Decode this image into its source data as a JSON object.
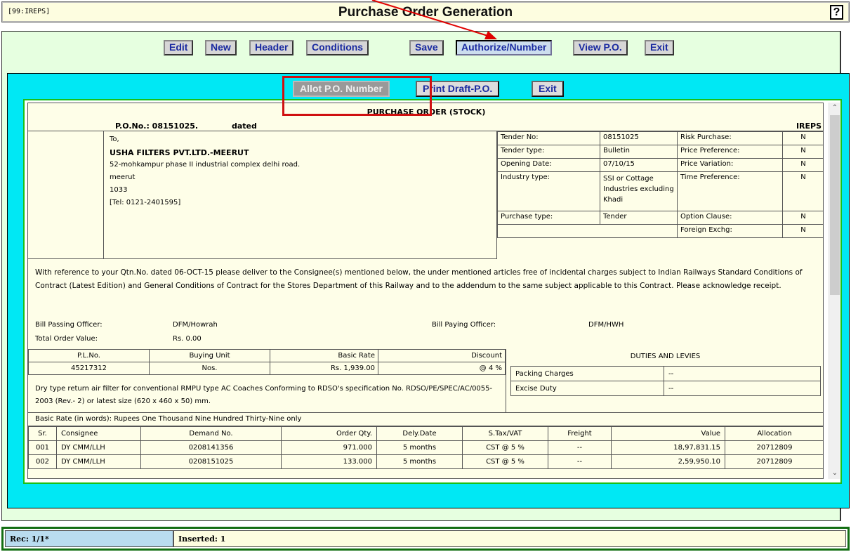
{
  "window": {
    "code": "[99:IREPS]",
    "title": "Purchase Order Generation",
    "help": "?"
  },
  "toolbar": [
    "Edit",
    "New",
    "Header",
    "Conditions",
    "Save",
    "Authorize/Number",
    "View P.O.",
    "Exit"
  ],
  "subtoolbar": {
    "allot": "Allot P.O. Number",
    "print": "Print Draft-P.O.",
    "exit": "Exit"
  },
  "doc": {
    "title": "PURCHASE ORDER (STOCK)",
    "po_no": "P.O.No.: 08151025.",
    "dated": "dated",
    "org": "IREPS",
    "to": "To,",
    "vendor": "USHA FILTERS PVT.LTD.-MEERUT",
    "addr1": "52-mohkampur phase II industrial complex delhi road.",
    "addr2": "meerut",
    "addr3": "1033",
    "tel": "[Tel: 0121-2401595]",
    "info": {
      "tender_no_l": "Tender No:",
      "tender_no": "08151025",
      "tender_type_l": "Tender type:",
      "tender_type": "Bulletin",
      "opening_l": "Opening Date:",
      "opening": "07/10/15",
      "industry_l": "Industry type:",
      "industry": "SSI or Cottage Industries excluding Khadi",
      "ptype_l": "Purchase type:",
      "ptype": "Tender",
      "risk_l": "Risk Purchase:",
      "risk": "N",
      "price_pref_l": "Price Preference:",
      "price_pref": "N",
      "price_var_l": "Price Variation:",
      "price_var": "N",
      "time_pref_l": "Time Preference:",
      "time_pref": "N",
      "option_l": "Option Clause:",
      "option": "N",
      "forex_l": "Foreign Exchg:",
      "forex": "N"
    },
    "para": "With reference to your Qtn.No. dated 06-OCT-15 please deliver to the Consignee(s) mentioned below, the under mentioned articles free of incidental charges subject to Indian Railways Standard Conditions of Contract (Latest Edition) and General Conditions of Contract for the Stores Department of this Railway and to the addendum to the same subject applicable to this Contract. Please acknowledge receipt.",
    "bill_passing_l": "Bill Passing Officer:",
    "bill_passing": "DFM/Howrah",
    "bill_paying_l": "Bill Paying Officer:",
    "bill_paying": "DFM/HWH",
    "total_l": "Total Order Value:",
    "total": "Rs. 0.00",
    "pl_headers": [
      "P.L.No.",
      "Buying Unit",
      "Basic Rate",
      "Discount"
    ],
    "pl_row": [
      "45217312",
      "Nos.",
      "Rs. 1,939.00",
      "@ 4 %"
    ],
    "duties_head": "DUTIES AND LEVIES",
    "duties": [
      [
        "Packing Charges",
        "--"
      ],
      [
        "Excise Duty",
        "--"
      ]
    ],
    "desc": "Dry type return air filter for conventional RMPU type AC Coaches Conforming to RDSO's specification No. RDSO/PE/SPEC/AC/0055-2003 (Rev.- 2) or latest size (620 x 460 x 50) mm.",
    "words": "Basic Rate (in words): Rupees One Thousand Nine Hundred Thirty-Nine only",
    "line_headers": [
      "Sr.",
      "Consignee",
      "Demand No.",
      "Order Qty.",
      "Dely.Date",
      "S.Tax/VAT",
      "Freight",
      "Value",
      "Allocation"
    ],
    "lines": [
      [
        "001",
        "DY CMM/LLH",
        "0208141356",
        "971.000",
        "5 months",
        "CST @ 5 %",
        "--",
        "18,97,831.15",
        "20712809"
      ],
      [
        "002",
        "DY CMM/LLH",
        "0208151025",
        "133.000",
        "5 months",
        "CST @ 5 %",
        "--",
        "2,59,950.10",
        "20712809"
      ]
    ]
  },
  "status": {
    "rec": "Rec: 1/1*",
    "inserted": "Inserted: 1"
  }
}
